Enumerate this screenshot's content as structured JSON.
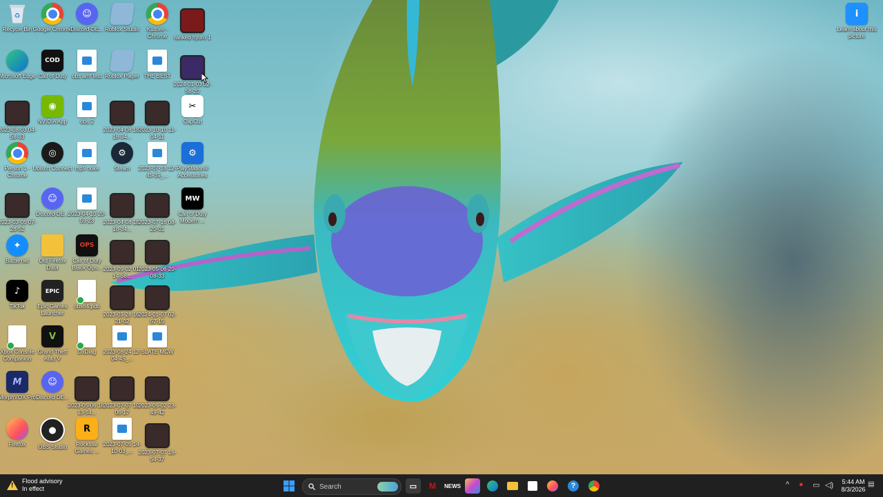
{
  "desktop": {
    "icons": [
      {
        "label": "Recycle Bin",
        "icon": "recycle-bin-icon"
      },
      {
        "label": "Google Chrome",
        "icon": "chrome-icon"
      },
      {
        "label": "Discord-DE...",
        "icon": "discord-icon"
      },
      {
        "label": "Roblox Studio",
        "icon": "roblox-studio-icon"
      },
      {
        "label": "Kultore - Chrome",
        "icon": "chrome-icon"
      },
      {
        "label": "ranked hydro 1",
        "icon": "video-thumbnail-icon"
      },
      {
        "label": "Microsoft Edge",
        "icon": "edge-icon"
      },
      {
        "label": "Call of Duty",
        "icon": "call-of-duty-icon"
      },
      {
        "label": "obs amf test",
        "icon": "document-icon"
      },
      {
        "label": "Roblox Player",
        "icon": "roblox-player-icon"
      },
      {
        "label": "THE BEST",
        "icon": "video-file-icon"
      },
      {
        "label": "2024-01-03 02-56-20",
        "icon": "video-thumbnail-icon"
      },
      {
        "label": "2023-08-03 04-58-33",
        "icon": "video-thumbnail-icon"
      },
      {
        "label": "NVIDIA App",
        "icon": "nvidia-icon"
      },
      {
        "label": "obs 2",
        "icon": "document-icon"
      },
      {
        "label": "2023-04-08 18-18-34...",
        "icon": "video-thumbnail-icon"
      },
      {
        "label": "2023-10-10 11-04-11",
        "icon": "video-thumbnail-icon"
      },
      {
        "label": "CapCut",
        "icon": "capcut-icon"
      },
      {
        "label": "Person 1 - Chrome",
        "icon": "chrome-icon"
      },
      {
        "label": "Ubisoft Connect",
        "icon": "ubisoft-icon"
      },
      {
        "label": "mp5 nuke",
        "icon": "video-file-icon"
      },
      {
        "label": "Steam",
        "icon": "steam-icon"
      },
      {
        "label": "2023-07-18 12-45-39_...",
        "icon": "video-file-icon"
      },
      {
        "label": "PlayStation® Accessories",
        "icon": "playstation-icon"
      },
      {
        "label": "2023-03-05 07-28-52",
        "icon": "video-thumbnail-icon"
      },
      {
        "label": "Discord-DE...",
        "icon": "discord-icon"
      },
      {
        "label": "2023-04-10 20-59-23",
        "icon": "video-file-icon"
      },
      {
        "label": "2023-04-08 18-18-34...",
        "icon": "video-thumbnail-icon"
      },
      {
        "label": "2023-07-16 08-20-01",
        "icon": "video-thumbnail-icon"
      },
      {
        "label": "Call of Duty Modern ...",
        "icon": "mw-icon"
      },
      {
        "label": "Battle.net",
        "icon": "battlenet-icon"
      },
      {
        "label": "Old Firefox Data",
        "icon": "folder-icon"
      },
      {
        "label": "Call of Duty Black Ops...",
        "icon": "black-ops-icon"
      },
      {
        "label": "2023-09-02 01-14-56...",
        "icon": "video-thumbnail-icon"
      },
      {
        "label": "2023-05-06 20-08-33",
        "icon": "video-thumbnail-icon"
      },
      {
        "label": "TikTok",
        "icon": "tiktok-icon"
      },
      {
        "label": "Epic Games Launcher",
        "icon": "epic-games-icon"
      },
      {
        "label": "obs64.pdb",
        "icon": "file-icon"
      },
      {
        "label": "2023-03-28 16-21-02",
        "icon": "video-thumbnail-icon"
      },
      {
        "label": "2024-01-07 02-57-15",
        "icon": "video-thumbnail-icon"
      },
      {
        "label": "Xbox Console Companion",
        "icon": "file-icon"
      },
      {
        "label": "Grand Theft Auto V",
        "icon": "gta-icon"
      },
      {
        "label": "DxDiag",
        "icon": "file-icon"
      },
      {
        "label": "2023-08-24 12-04-45_...",
        "icon": "video-file-icon"
      },
      {
        "label": "SLATE MCW",
        "icon": "video-file-icon"
      },
      {
        "label": "MorphVOX Pro",
        "icon": "morphvox-icon"
      },
      {
        "label": "Discord-DE...",
        "icon": "discord-icon"
      },
      {
        "label": "2023-05-06 18-13-54...",
        "icon": "video-thumbnail-icon"
      },
      {
        "label": "2023-07-07 10-06-17",
        "icon": "video-thumbnail-icon"
      },
      {
        "label": "2023-09-02 23-49-42",
        "icon": "video-thumbnail-icon"
      },
      {
        "label": "Firefox",
        "icon": "firefox-icon"
      },
      {
        "label": "OBS Studio",
        "icon": "obs-icon"
      },
      {
        "label": "Rockstar Games ...",
        "icon": "rockstar-icon"
      },
      {
        "label": "2023-07-05 14-10-03_...",
        "icon": "video-file-icon"
      },
      {
        "label": "2023-07-07 16-54-37",
        "icon": "video-thumbnail-icon"
      }
    ],
    "learn": {
      "label": "Learn about this picture",
      "icon": "info-icon"
    }
  },
  "taskbar": {
    "weather": {
      "title": "Flood advisory",
      "subtitle": "In effect",
      "icon": "warning-icon"
    },
    "search_placeholder": "Search",
    "apps": [
      "start-icon",
      "task-view-icon",
      "mcafee-icon",
      "news-icon",
      "copilot-icon",
      "edge-icon",
      "file-explorer-icon",
      "store-icon",
      "firefox-icon",
      "help-icon",
      "chrome-icon"
    ],
    "tray": [
      "chevron-up-icon",
      "antivirus-icon",
      "network-icon",
      "volume-icon"
    ],
    "clock": {
      "time": "5:44 AM",
      "date": "8/3/2026"
    },
    "colors": {
      "taskbar": "#202020",
      "accent": "#0078d4"
    }
  }
}
